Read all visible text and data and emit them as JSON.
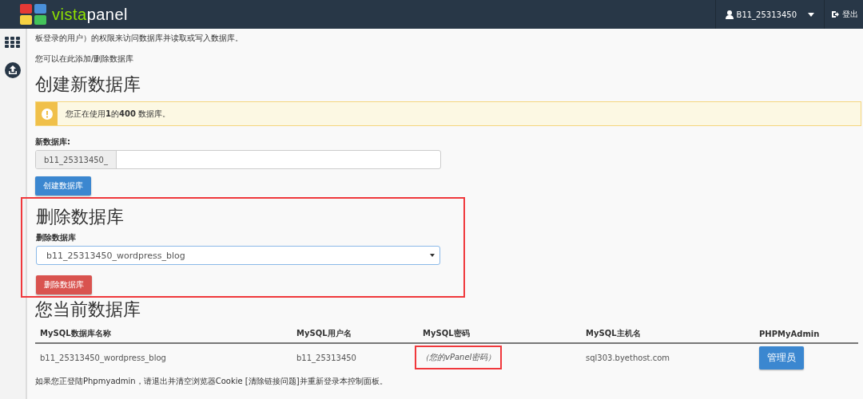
{
  "header": {
    "logo": {
      "first": "vista",
      "second": "panel"
    },
    "user": "B11_25313450",
    "logout": "登出"
  },
  "intro": {
    "lines": [
      "板登录的用户）的权限来访问数据库并读取或写入数据库。"
    ],
    "note": "您可以在此添加/删除数据库"
  },
  "create": {
    "title": "创建新数据库",
    "alert": "您正在使用**1**的**400** 数据库。",
    "label": "新数据库:",
    "prefix": "b11_25313450_",
    "button": "创建数据库"
  },
  "delete": {
    "highlighted": true,
    "title": "删除数据库",
    "label": "删除数据库",
    "value": "b11_25313450_wordpress_blog",
    "button": "删除数据库"
  },
  "current": {
    "title": "您当前数据库",
    "columns": [
      "MySQL数据库名称",
      "MySQL用户名",
      "MySQL密码",
      "MySQL主机名",
      "PHPMyAdmin"
    ],
    "rows": [
      {
        "name": "b11_25313450_wordpress_blog",
        "user": "b11_25313450",
        "password": "（您的vPanel密码）",
        "password_highlighted": true,
        "host": "sql303.byethost.com",
        "action": "管理员"
      }
    ]
  },
  "footer": {
    "before": "如果您正登陆Phpmyadmin，请退出并清空浏览器Cookie ",
    "link": "[清除链接问题]",
    "after": "并重新登录本控制面板。"
  }
}
